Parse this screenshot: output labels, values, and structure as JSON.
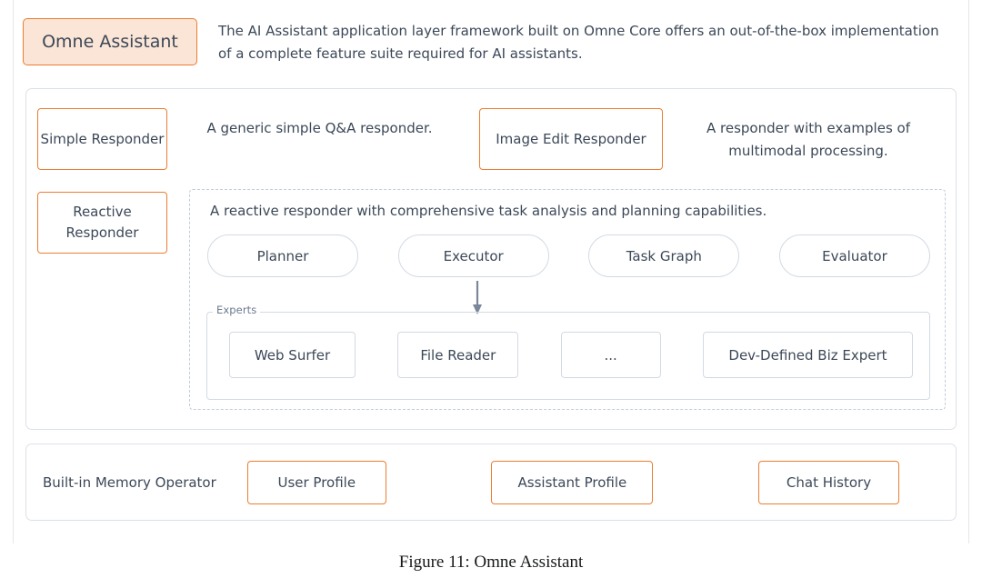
{
  "figure": {
    "caption": "Figure 11: Omne Assistant"
  },
  "header": {
    "badge_label": "Omne Assistant",
    "description": "The AI Assistant application layer framework built on Omne Core offers an out-of-the-box implementation of a complete feature suite required for AI assistants."
  },
  "responders": {
    "simple": {
      "label": "Simple Responder",
      "description": "A generic simple Q&A responder."
    },
    "image_edit": {
      "label": "Image Edit Responder",
      "description": "A responder with examples of multimodal processing."
    },
    "reactive": {
      "label": "Reactive Responder",
      "description": "A reactive responder with comprehensive task analysis and planning capabilities.",
      "pipeline": [
        {
          "label": "Planner"
        },
        {
          "label": "Executor"
        },
        {
          "label": "Task Graph"
        },
        {
          "label": "Evaluator"
        }
      ],
      "experts": {
        "legend": "Experts",
        "items": [
          {
            "label": "Web Surfer"
          },
          {
            "label": "File Reader"
          },
          {
            "label": "..."
          },
          {
            "label": "Dev-Defined Biz Expert"
          }
        ]
      }
    }
  },
  "memory": {
    "operator_label": "Built-in Memory Operator",
    "items": [
      {
        "label": "User Profile"
      },
      {
        "label": "Assistant Profile"
      },
      {
        "label": "Chat History"
      }
    ]
  },
  "colors": {
    "accent_orange": "#ed7d31",
    "badge_fill": "#fbe5d6",
    "panel_border": "#dbe1e9",
    "dashed_border": "#c3ccd8",
    "pill_border": "#d3dae3",
    "text": "#3c4858",
    "muted_text": "#6b7a90",
    "arrow": "#7a879b"
  }
}
